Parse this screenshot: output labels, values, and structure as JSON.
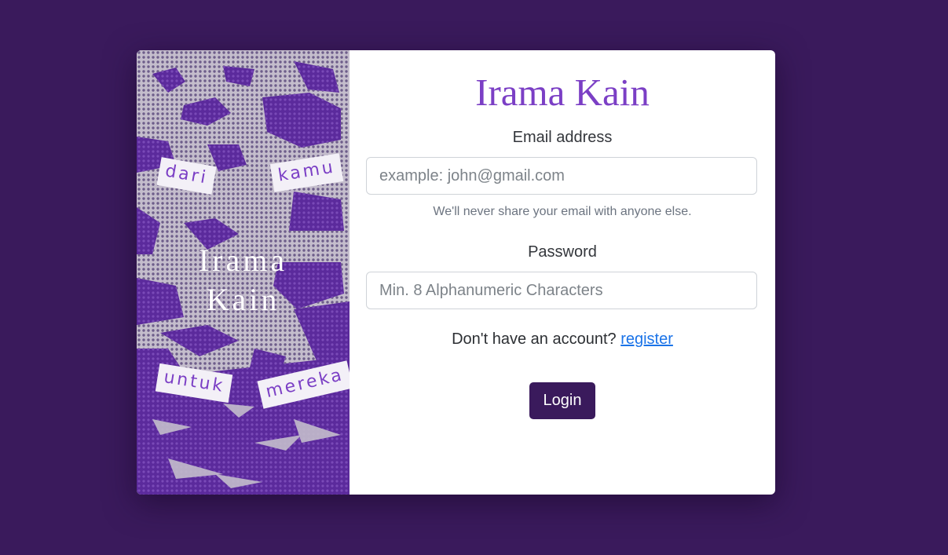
{
  "art": {
    "title_line1": "Irama",
    "title_line2": "Kain",
    "tags": [
      "dari",
      "kamu",
      "untuk",
      "mereka"
    ],
    "colors": {
      "purple": "#5a2a9a",
      "halftone": "#b3abc0"
    }
  },
  "form": {
    "brand": "Irama Kain",
    "email_label": "Email address",
    "email_placeholder": "example: john@gmail.com",
    "email_help": "We'll never share your email with anyone else.",
    "password_label": "Password",
    "password_placeholder": "Min. 8 Alphanumeric Characters",
    "register_prompt": "Don't have an account?",
    "register_link": "register",
    "login_label": "Login"
  },
  "theme": {
    "page_bg": "#3a1a5c",
    "brand_color": "#7b3fc5",
    "link_color": "#1a73e8"
  }
}
